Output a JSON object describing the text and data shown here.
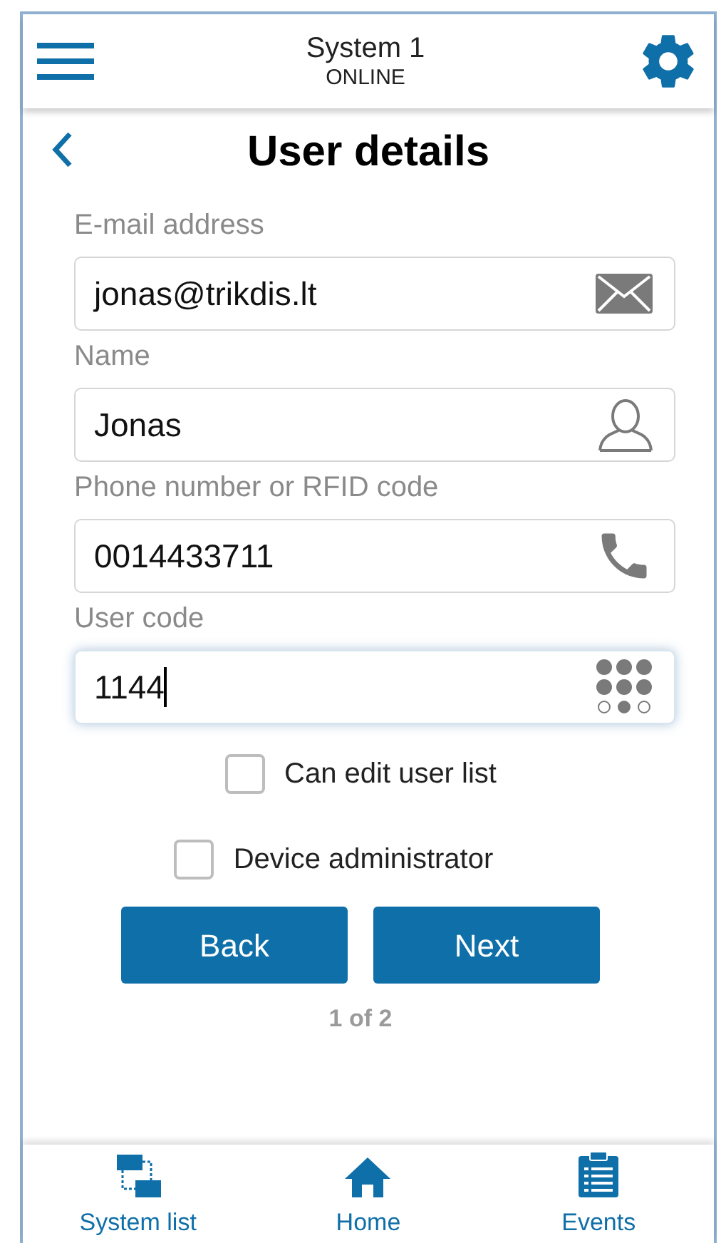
{
  "header": {
    "title": "System 1",
    "status": "ONLINE"
  },
  "page": {
    "title": "User details"
  },
  "fields": [
    {
      "label": "E-mail address",
      "value": "jonas@trikdis.lt",
      "kind": "email",
      "focused": false
    },
    {
      "label": "Name",
      "value": "Jonas",
      "kind": "person",
      "focused": false
    },
    {
      "label": "Phone number or RFID code",
      "value": "0014433711",
      "kind": "phone",
      "focused": false
    },
    {
      "label": "User code",
      "value": "1144",
      "kind": "keypad",
      "focused": true
    }
  ],
  "checkboxes": [
    {
      "label": "Can edit user list",
      "checked": false
    },
    {
      "label": "Device administrator",
      "checked": false
    }
  ],
  "buttons": [
    "Back",
    "Next"
  ],
  "pager": "1 of 2",
  "nav": [
    {
      "label": "System list",
      "kind": "systems"
    },
    {
      "label": "Home",
      "kind": "home"
    },
    {
      "label": "Events",
      "kind": "events"
    }
  ]
}
